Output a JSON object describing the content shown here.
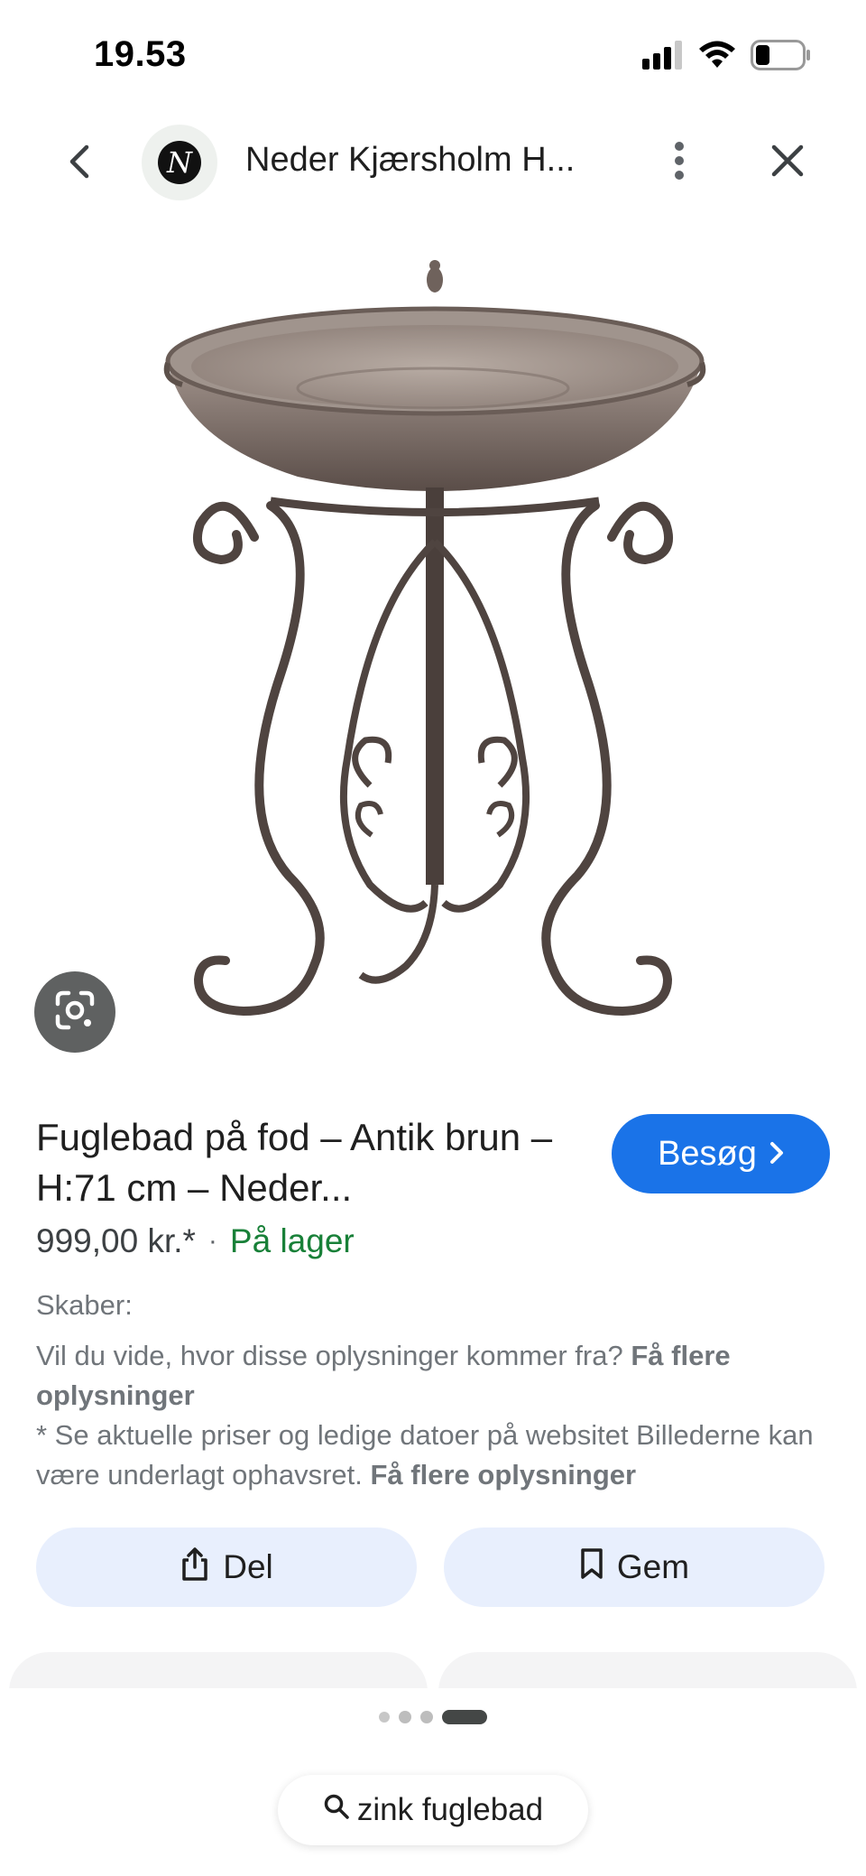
{
  "status_bar": {
    "time": "19.53"
  },
  "header": {
    "logo_letter": "N",
    "site_title": "Neder Kjærsholm H..."
  },
  "product": {
    "title": "Fuglebad på fod – Antik brun – H:71 cm – Neder...",
    "visit_label": "Besøg",
    "price": "999,00 kr.*",
    "separator": "·",
    "stock": "På lager",
    "creator_label": "Skaber:",
    "info_question": "Vil du vide, hvor disse oplysninger kommer fra?",
    "info_link": "Få flere oplysninger",
    "disclaimer": "* Se aktuelle priser og ledige datoer på websitet Billederne kan være underlagt ophavsret.",
    "disclaimer_link": "Få flere oplysninger"
  },
  "actions": {
    "share_label": "Del",
    "save_label": "Gem"
  },
  "pager": {
    "pages": 4,
    "active_index": 3
  },
  "search": {
    "query": "zink fuglebad"
  },
  "colors": {
    "accent": "#1a73e8",
    "stock_green": "#188038",
    "action_bg": "#e8effd",
    "muted_text": "#70757a"
  },
  "icons": {
    "back": "chevron-left-icon",
    "more": "more-vert-icon",
    "close": "close-icon",
    "lens": "google-lens-icon",
    "visit": "chevron-right-icon",
    "share": "share-icon",
    "save": "bookmark-icon",
    "search": "search-icon"
  }
}
